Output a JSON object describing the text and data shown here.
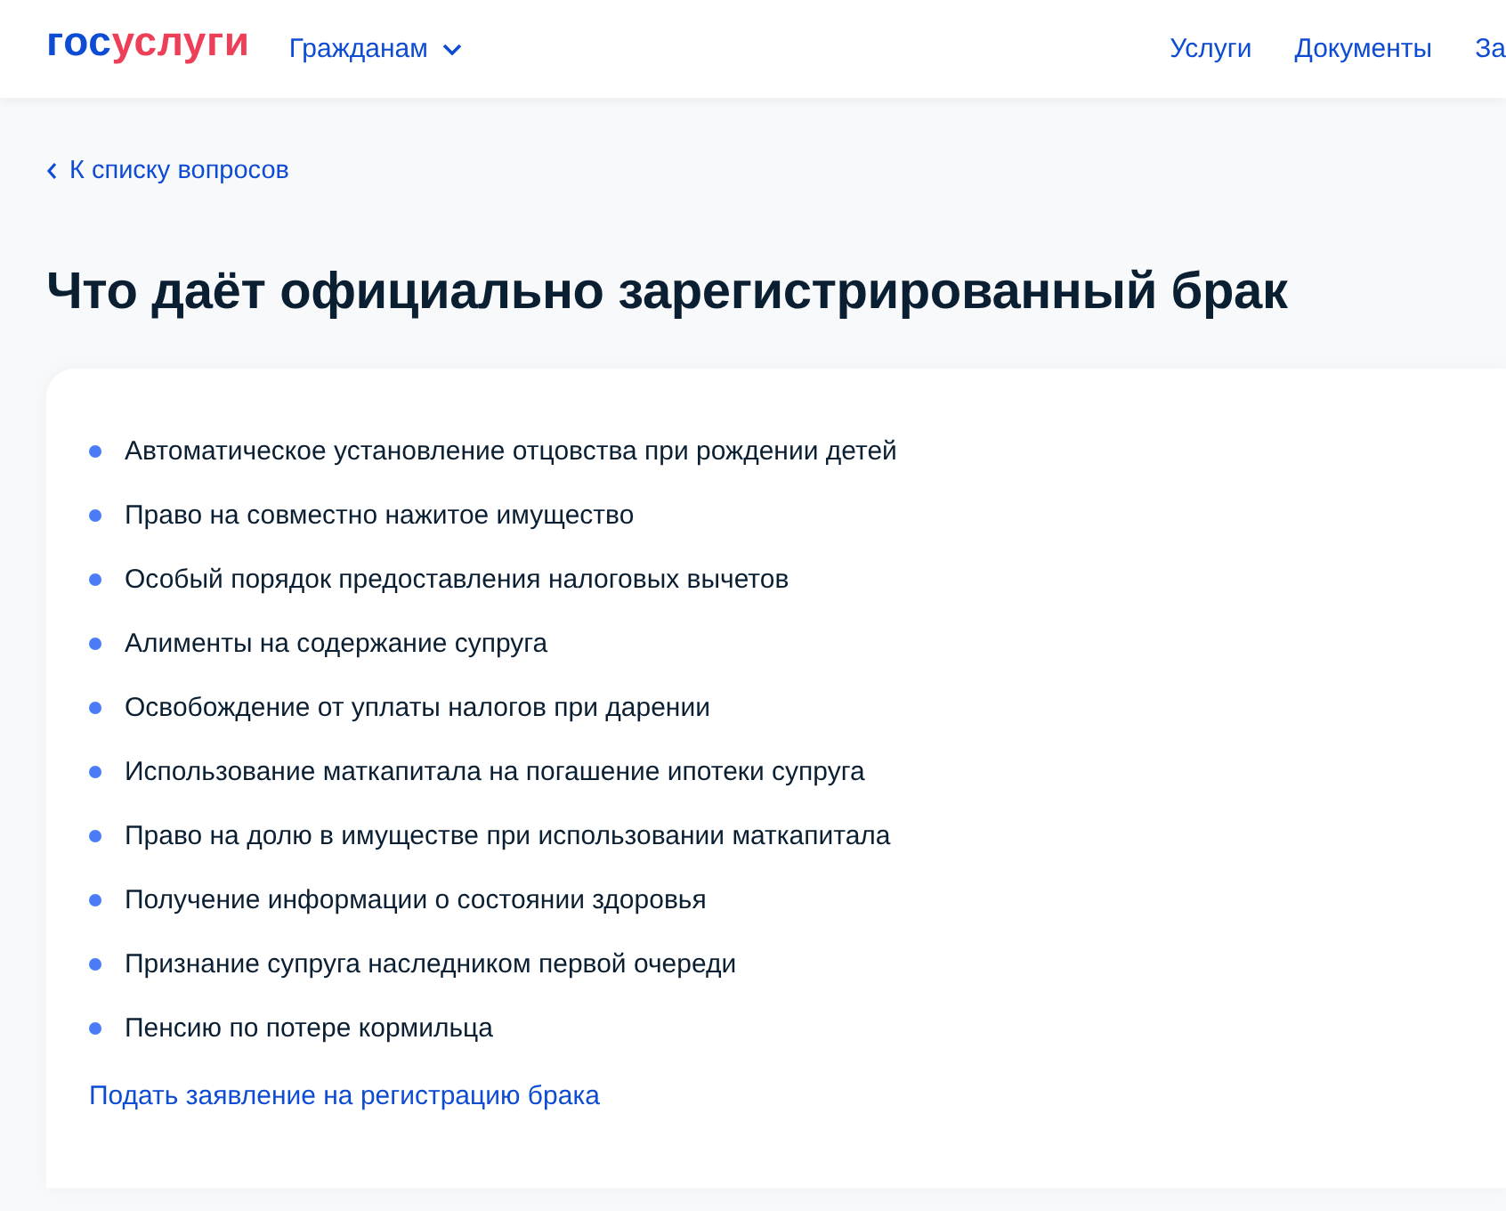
{
  "header": {
    "logo": [
      {
        "text": "гос",
        "color": "#0d4cd3"
      },
      {
        "text": "услуги",
        "color": "#ee3f58"
      }
    ],
    "menu": {
      "label": "Гражданам",
      "expanded": false
    },
    "nav": [
      "Услуги",
      "Документы",
      "За"
    ]
  },
  "back_link": "К списку вопросов",
  "title": "Что даёт официально зарегистрированный брак",
  "card": {
    "items": [
      "Автоматическое установление отцовства при рождении детей",
      "Право на совместно нажитое имущество",
      "Особый порядок предоставления налоговых вычетов",
      "Алименты на содержание супруга",
      "Освобождение от уплаты налогов при дарении",
      "Использование маткапитала на погашение ипотеки супруга",
      "Право на долю в имуществе при использовании маткапитала",
      "Получение информации о состоянии здоровья",
      "Признание супруга наследником первой очереди",
      "Пенсию по потере кормильца"
    ],
    "link": "Подать заявление на регистрацию брака"
  }
}
